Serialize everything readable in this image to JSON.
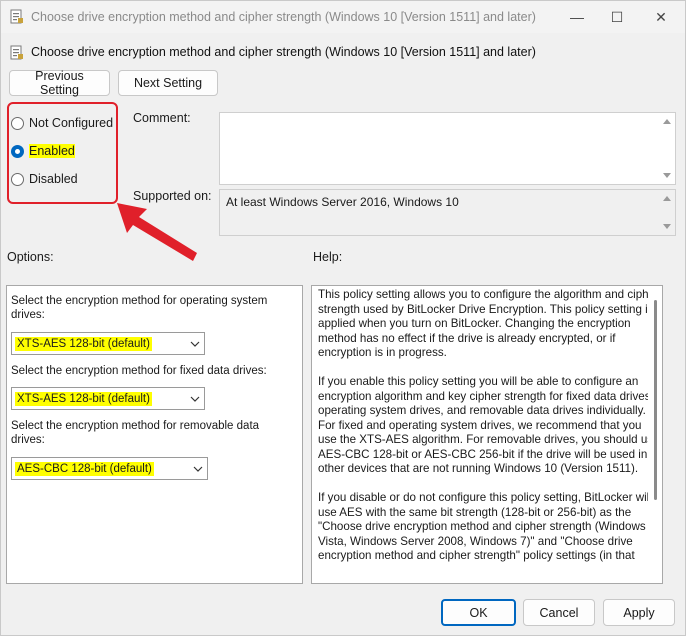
{
  "window": {
    "title": "Choose drive encryption method and cipher strength (Windows 10 [Version 1511] and later)",
    "subtitle": "Choose drive encryption method and cipher strength (Windows 10 [Version 1511] and later)",
    "controls": {
      "minimize": "—",
      "maximize": "☐",
      "close": "✕"
    }
  },
  "nav": {
    "previous": "Previous Setting",
    "next": "Next Setting"
  },
  "state": {
    "options": [
      {
        "label": "Not Configured",
        "checked": false
      },
      {
        "label": "Enabled",
        "checked": true
      },
      {
        "label": "Disabled",
        "checked": false
      }
    ]
  },
  "comment": {
    "label": "Comment:",
    "value": ""
  },
  "supported": {
    "label": "Supported on:",
    "value": "At least Windows Server 2016, Windows 10"
  },
  "options_label": "Options:",
  "help_label": "Help:",
  "options": [
    {
      "label": "Select the encryption method for operating system drives:",
      "value": "XTS-AES 128-bit (default)"
    },
    {
      "label": "Select the encryption method for fixed data drives:",
      "value": "XTS-AES 128-bit (default)"
    },
    {
      "label": "Select the encryption method for removable data drives:",
      "value": "AES-CBC 128-bit  (default)"
    }
  ],
  "help": [
    "This policy setting allows you to configure the algorithm and cipher strength used by BitLocker Drive Encryption. This policy setting is applied when you turn on BitLocker. Changing the encryption method has no effect if the drive is already encrypted, or if encryption is in progress.",
    "If you enable this policy setting you will be able to configure an encryption algorithm and key cipher strength for fixed data drives, operating system drives, and removable data drives individually. For fixed and operating system drives, we recommend that you use the XTS-AES algorithm. For removable drives, you should use AES-CBC 128-bit or AES-CBC 256-bit if the drive will be used in other devices that are not running Windows 10 (Version 1511).",
    "If you disable or do not configure this policy setting, BitLocker will use AES with the same bit strength (128-bit or 256-bit) as the \"Choose drive encryption method and cipher strength (Windows Vista, Windows Server 2008, Windows 7)\" and \"Choose drive encryption method and cipher strength\" policy settings (in that"
  ],
  "footer": {
    "ok": "OK",
    "cancel": "Cancel",
    "apply": "Apply"
  },
  "colors": {
    "accent": "#0067c0",
    "annotation": "#e0202a",
    "highlight": "#ffff00"
  },
  "icons": [
    "policy-icon",
    "minimize-icon",
    "maximize-icon",
    "close-icon",
    "chevron-down-icon",
    "annotation-arrow"
  ]
}
